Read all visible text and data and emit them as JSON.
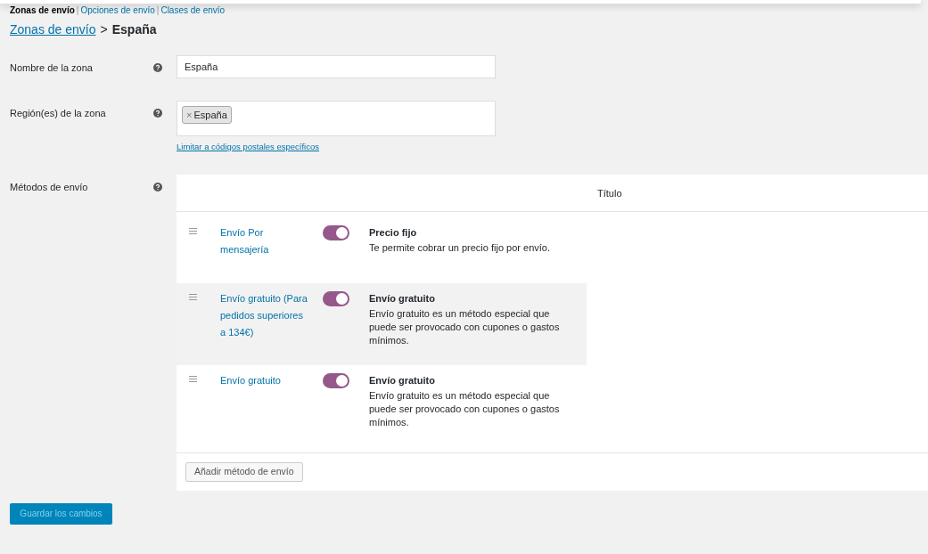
{
  "subnav": [
    {
      "label": "Zonas de envío",
      "selected": true
    },
    {
      "label": "Opciones de envío",
      "selected": false
    },
    {
      "label": "Clases de envío",
      "selected": false
    }
  ],
  "subnav_separator": "|",
  "breadcrumb": {
    "link": "Zonas de envío",
    "separator": ">",
    "current": "España"
  },
  "zone_name": {
    "label": "Nombre de la zona",
    "value": "España"
  },
  "zone_regions": {
    "label": "Región(es) de la zona",
    "tags": [
      {
        "remove": "×",
        "label": "España"
      }
    ],
    "link": "Limitar a códigos postales específicos"
  },
  "shipping_methods": {
    "label": "Métodos de envío",
    "columns": [
      "Título"
    ],
    "rows": [
      {
        "name": "Envío Por mensajería",
        "enabled": true,
        "highlighted": false,
        "title": "Precio fijo",
        "description": "Te permite cobrar un precio fijo por envío."
      },
      {
        "name": "Envío gratuito (Para pedidos superiores a 134€)",
        "enabled": true,
        "highlighted": true,
        "title": "Envío gratuito",
        "description": "Envío gratuito es un método especial que puede ser provocado con cupones o gastos mínimos."
      },
      {
        "name": "Envío gratuito",
        "enabled": true,
        "highlighted": false,
        "title": "Envío gratuito",
        "description": "Envío gratuito es un método especial que puede ser provocado con cupones o gastos mínimos."
      }
    ],
    "add_button": "Añadir método de envío"
  },
  "save_button": "Guardar los cambios"
}
